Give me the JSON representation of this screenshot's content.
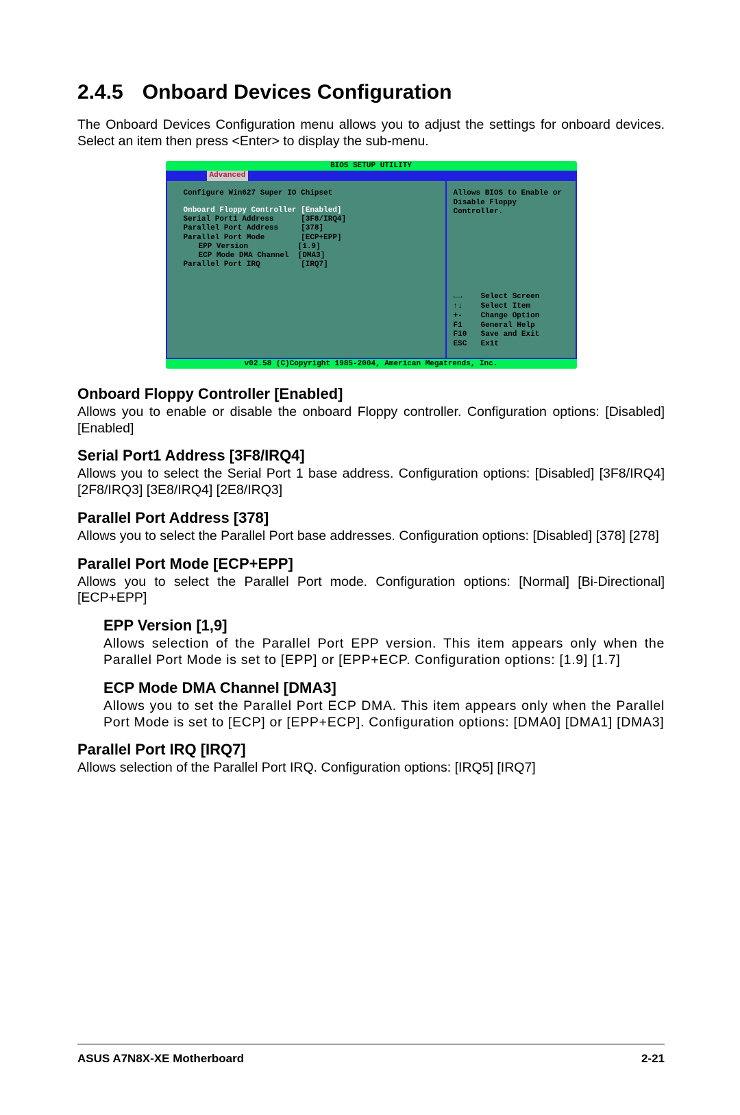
{
  "section_number": "2.4.5",
  "section_title": "Onboard Devices Configuration",
  "intro": "The Onboard Devices Configuration menu allows you to adjust the settings for onboard devices. Select an item then press <Enter> to display the sub-menu.",
  "bios": {
    "title": "BIOS SETUP UTILITY",
    "tab": "Advanced",
    "subtitle": "Configure Win627 Super IO Chipset",
    "fields": [
      {
        "label": "Onboard Floppy Controller",
        "value": "[Enabled]",
        "hl": true,
        "indent": false
      },
      {
        "label": "Serial Port1 Address",
        "value": "[3F8/IRQ4]",
        "hl": false,
        "indent": false
      },
      {
        "label": "Parallel Port Address",
        "value": "[378]",
        "hl": false,
        "indent": false
      },
      {
        "label": "Parallel Port Mode",
        "value": "[ECP+EPP]",
        "hl": false,
        "indent": false
      },
      {
        "label": "EPP Version",
        "value": "[1.9]",
        "hl": false,
        "indent": true
      },
      {
        "label": "ECP Mode DMA Channel",
        "value": "[DMA3]",
        "hl": false,
        "indent": true
      },
      {
        "label": "Parallel Port IRQ",
        "value": "[IRQ7]",
        "hl": false,
        "indent": false
      }
    ],
    "help": "Allows BIOS to Enable or Disable Floppy Controller.",
    "keys": [
      {
        "key": "←→",
        "action": "Select Screen"
      },
      {
        "key": "↑↓",
        "action": "Select Item"
      },
      {
        "key": "+-",
        "action": "Change Option"
      },
      {
        "key": "F1",
        "action": "General Help"
      },
      {
        "key": "F10",
        "action": "Save and Exit"
      },
      {
        "key": "ESC",
        "action": "Exit"
      }
    ],
    "copyright": "v02.58 (C)Copyright 1985-2004, American Megatrends, Inc."
  },
  "options": [
    {
      "heading": "Onboard Floppy Controller [Enabled]",
      "body": "Allows you to enable or disable the onboard Floppy controller. Configuration options: [Disabled] [Enabled]",
      "indent": false
    },
    {
      "heading": "Serial Port1 Address [3F8/IRQ4]",
      "body": "Allows you to select the Serial Port 1 base address. Configuration options: [Disabled] [3F8/IRQ4] [2F8/IRQ3] [3E8/IRQ4] [2E8/IRQ3]",
      "indent": false
    },
    {
      "heading": "Parallel Port Address [378]",
      "body": "Allows you to select the Parallel Port base addresses. Configuration options: [Disabled] [378] [278]",
      "indent": false
    },
    {
      "heading": "Parallel Port Mode [ECP+EPP]",
      "body": "Allows you to select the Parallel Port mode. Configuration options: [Normal] [Bi-Directional] [ECP+EPP]",
      "indent": false
    },
    {
      "heading": "EPP Version [1,9]",
      "body": "Allows selection of the Parallel Port EPP version. This item appears only when the Parallel Port Mode is set to [EPP] or [EPP+ECP. Configuration options: [1.9] [1.7]",
      "indent": true
    },
    {
      "heading": "ECP Mode DMA Channel [DMA3]",
      "body": "Allows you to set the Parallel Port ECP DMA. This item appears only when the Parallel Port Mode is set to [ECP] or [EPP+ECP]. Configuration options: [DMA0] [DMA1] [DMA3]",
      "indent": true
    },
    {
      "heading": "Parallel Port IRQ [IRQ7]",
      "body": "Allows selection of the Parallel Port IRQ. Configuration options: [IRQ5] [IRQ7]",
      "indent": false
    }
  ],
  "footer_left": "ASUS A7N8X-XE Motherboard",
  "footer_right": "2-21"
}
